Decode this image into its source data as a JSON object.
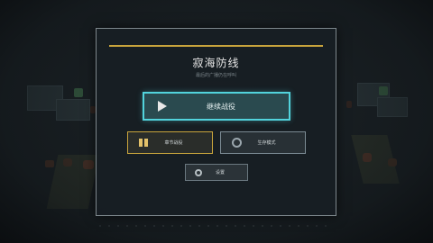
{
  "game": {
    "title": "寂海防线",
    "subtitle": "最后的广播仍在呼叫"
  },
  "menu": {
    "continue_label": "继续战役",
    "story_label": "章节战役",
    "survival_label": "生存模式",
    "settings_label": "设置"
  },
  "colors": {
    "accent_gold": "#c8a43c",
    "accent_cyan": "#52d3dc",
    "panel_bg": "#181e23"
  },
  "icons": {
    "continue": "play-icon",
    "story": "book-icon",
    "survival": "ring-icon",
    "settings": "gear-icon"
  }
}
